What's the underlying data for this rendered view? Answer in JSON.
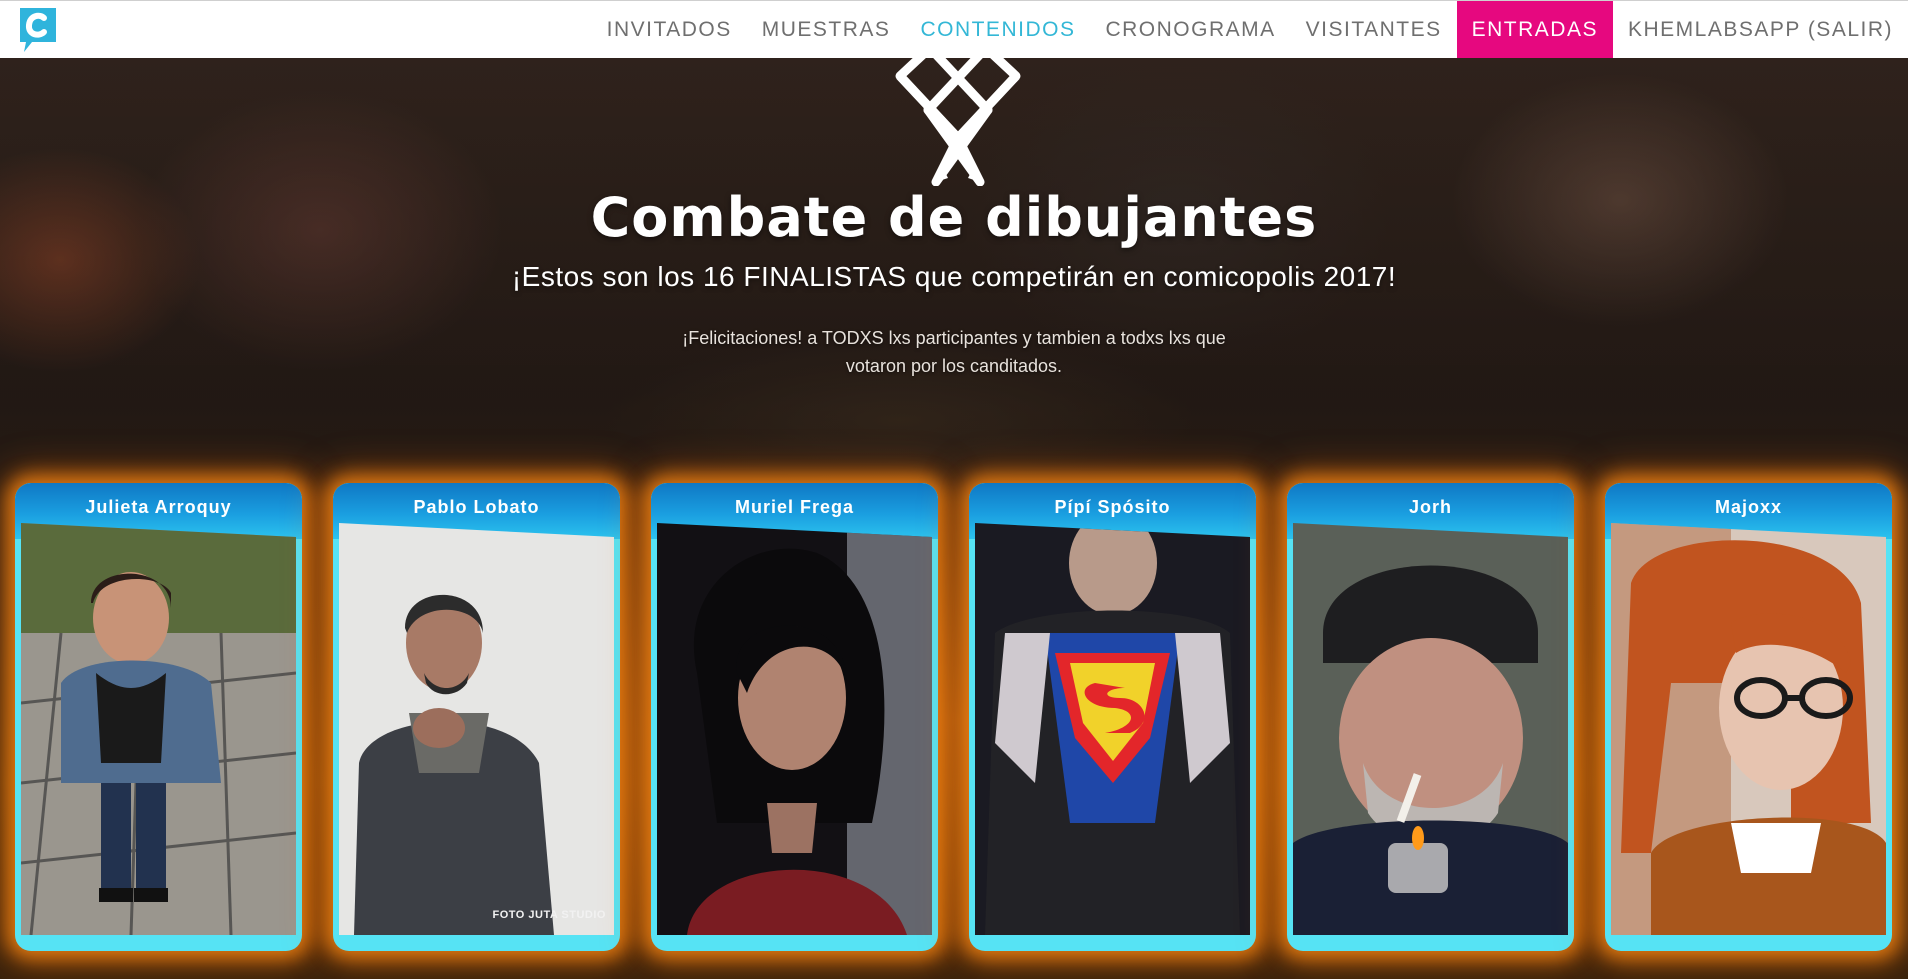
{
  "nav": {
    "logo_icon": "comicopolis-c-logo",
    "items": [
      {
        "label": "INVITADOS",
        "state": "default"
      },
      {
        "label": "MUESTRAS",
        "state": "default"
      },
      {
        "label": "CONTENIDOS",
        "state": "active"
      },
      {
        "label": "CRONOGRAMA",
        "state": "default"
      },
      {
        "label": "VISITANTES",
        "state": "default"
      },
      {
        "label": "ENTRADAS",
        "state": "cta"
      },
      {
        "label": "KHEMLABSAPP (SALIR)",
        "state": "default"
      }
    ]
  },
  "hero": {
    "emblem_icon": "crossed-pencils-icon",
    "title": "Combate de dibujantes",
    "subtitle": "¡Estos son los 16 FINALISTAS que competirán en comicopolis 2017!",
    "description": "¡Felicitaciones! a TODXS lxs participantes y tambien a todxs lxs que votaron por los canditados."
  },
  "finalists": [
    {
      "name": "Julieta Arroquy"
    },
    {
      "name": "Pablo Lobato",
      "photo_credit": "FOTO JUTA STUDIO"
    },
    {
      "name": "Muriel Frega"
    },
    {
      "name": "Pípí Spósito"
    },
    {
      "name": "Jorh"
    },
    {
      "name": "Majoxx"
    }
  ],
  "colors": {
    "nav_active": "#33b7d6",
    "nav_cta_bg": "#e6087f",
    "nav_text": "#6f6f6f",
    "card_frame": "#56e3f4",
    "card_header": "#1a9ee0",
    "card_glow": "#ff8c14"
  }
}
